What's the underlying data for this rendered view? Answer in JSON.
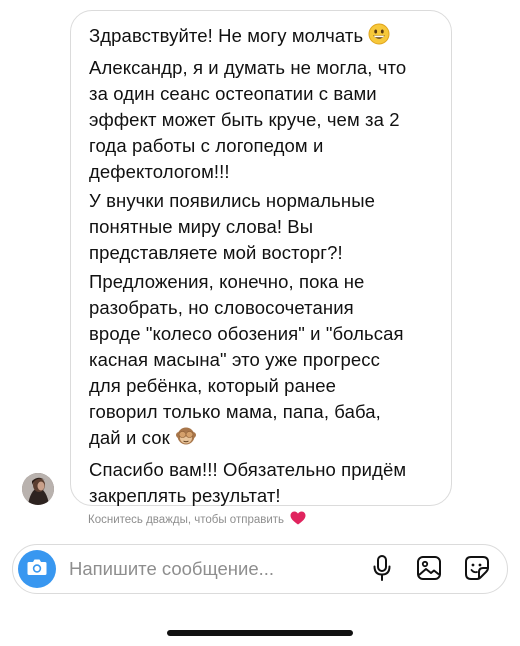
{
  "message": {
    "paragraphs": [
      "Здравствуйте! Не могу молчать",
      "Александр, я и думать не могла, что\nза один сеанс остеопатии с вами\nэффект может быть круче, чем за 2\nгода работы с логопедом и\nдефектологом!!!",
      "У внучки появились нормальные\nпонятные миру слова! Вы\nпредставляете мой восторг?!",
      "Предложения, конечно, пока не\nразобрать, но словосочетания\nвроде \"колесо обозения\" и \"больсая\nкасная масына\" это уже прогресс\nдля ребёнка, который ранее\nговорил только мама, папа, баба,\nдай и сок",
      "Спасибо вам!!! Обязательно придём\nзакреплять результат!"
    ],
    "emoji_1": "grinning-face-emoji",
    "emoji_2": "see-no-evil-monkey-emoji"
  },
  "hint": {
    "text": "Коснитесь дважды, чтобы отправить",
    "icon": "red-heart-emoji"
  },
  "composer": {
    "placeholder": "Напишите сообщение...",
    "camera_icon": "camera-icon",
    "mic_icon": "microphone-icon",
    "gallery_icon": "gallery-icon",
    "sticker_icon": "sticker-icon"
  },
  "colors": {
    "accent": "#3897f0",
    "heart": "#e0245e",
    "hint_text": "#8e8e8e",
    "border": "#dbdbdb"
  }
}
